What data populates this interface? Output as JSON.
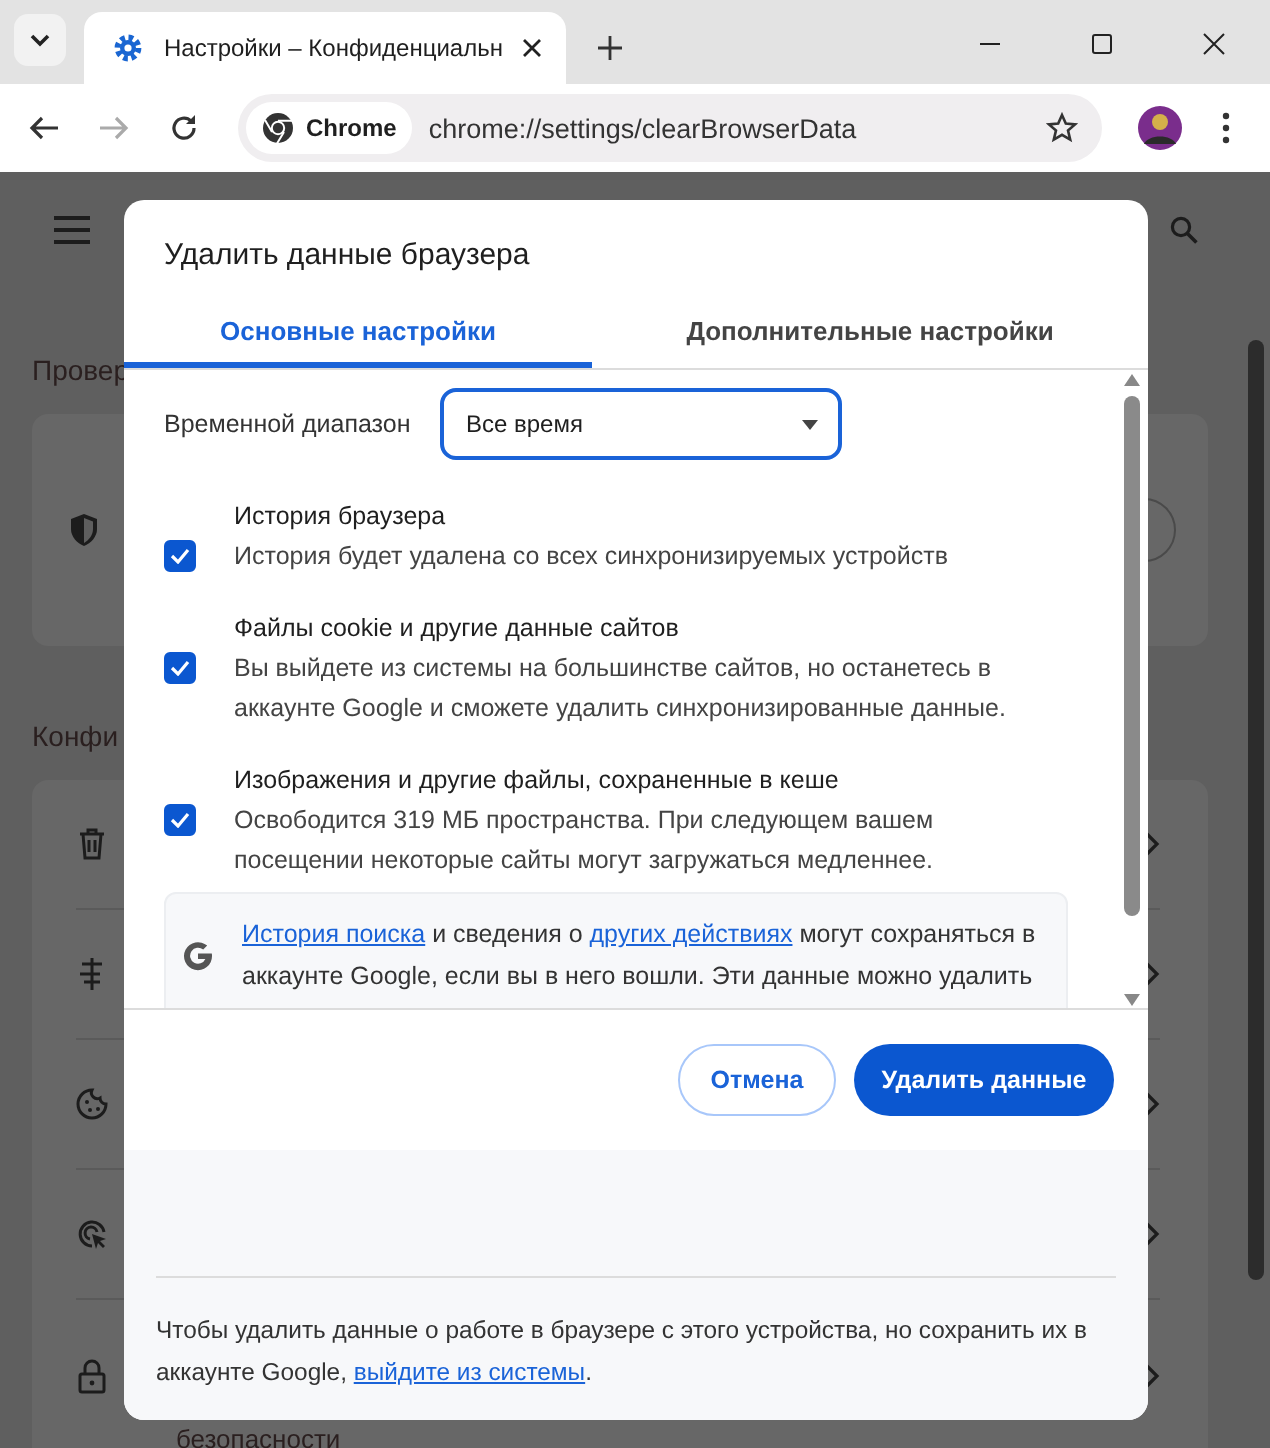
{
  "browser": {
    "tabs": [
      {
        "title": "Настройки – Конфиденциальн",
        "selected": true
      }
    ],
    "address": {
      "chip": "Chrome",
      "url": "chrome://settings/clearBrowserData"
    }
  },
  "background": {
    "section_1": "Провер",
    "section_2": "Конфи",
    "caption": "безопасности"
  },
  "dialog": {
    "title": "Удалить данные браузера",
    "tabs": [
      {
        "label": "Основные настройки",
        "selected": true
      },
      {
        "label": "Дополнительные настройки",
        "selected": false
      }
    ],
    "time_range": {
      "label": "Временной диапазон",
      "value": "Все время"
    },
    "options": [
      {
        "title": "История браузера",
        "description": "История будет удалена со всех синхронизируемых устройств",
        "checked": true
      },
      {
        "title": "Файлы cookie и другие данные сайтов",
        "description": "Вы выйдете из системы на большинстве сайтов, но останетесь в аккаунте Google и сможете удалить синхронизированные данные.",
        "checked": true
      },
      {
        "title": "Изображения и другие файлы, сохраненные в кеше",
        "description": "Освободится 319 МБ пространства. При следующем вашем посещении некоторые сайты могут загружаться медленнее.",
        "checked": true
      }
    ],
    "notice": [
      {
        "text": "История поиска",
        "link": true
      },
      {
        "text": " и сведения о ",
        "link": false
      },
      {
        "text": "других действиях",
        "link": true
      },
      {
        "text": " могут сохраняться в аккаунте Google, если вы в него вошли. Эти данные можно удалить",
        "link": false
      }
    ],
    "buttons": [
      {
        "label": "Отмена",
        "kind": "secondary"
      },
      {
        "label": "Удалить данные",
        "kind": "primary"
      }
    ],
    "footer": [
      {
        "text": "Чтобы удалить данные о работе в браузере с этого устройства, но сохранить их в аккаунте Google, ",
        "link": false
      },
      {
        "text": "выйдите из системы",
        "link": true
      },
      {
        "text": ".",
        "link": false
      }
    ]
  }
}
